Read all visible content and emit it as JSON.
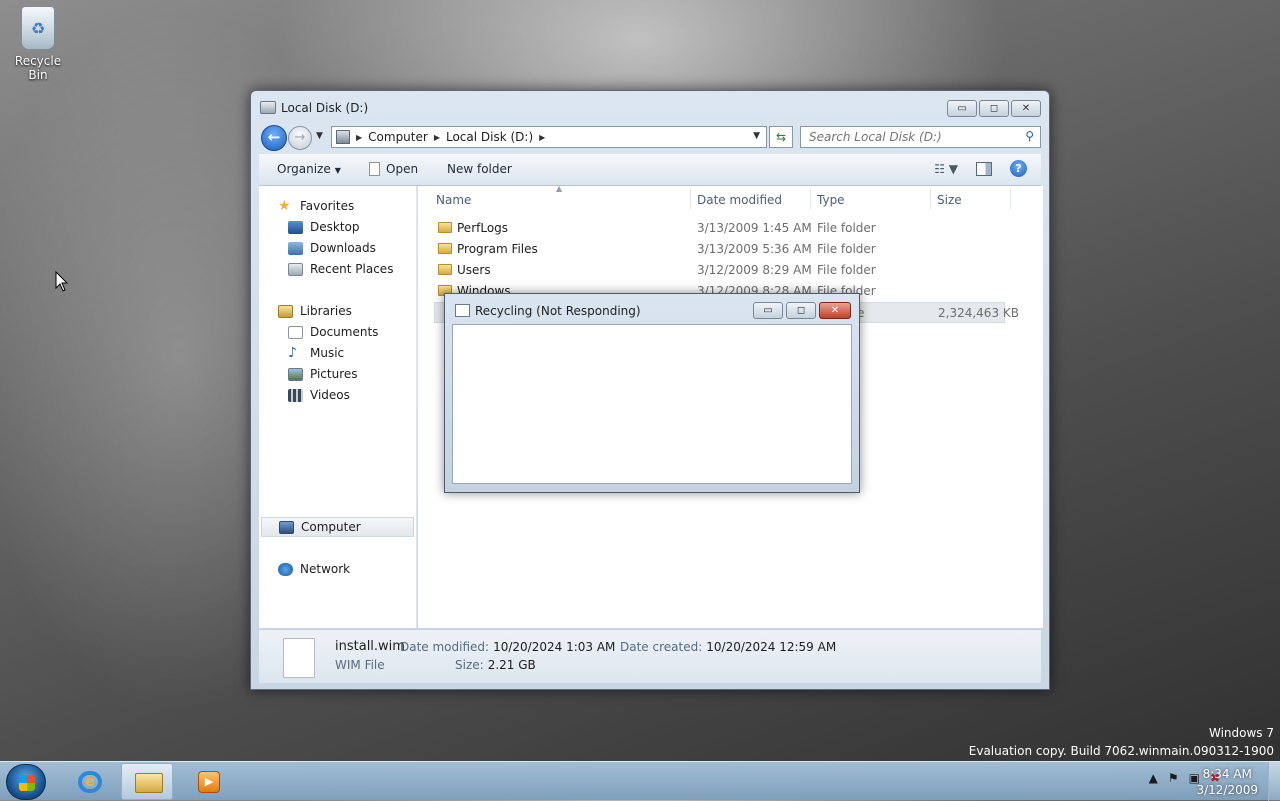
{
  "desktop": {
    "recycle_bin_label": "Recycle Bin",
    "watermark_line1": "Windows 7",
    "watermark_line2": "Evaluation copy. Build 7062.winmain.090312-1900"
  },
  "explorer": {
    "title": "Local Disk (D:)",
    "caption_buttons": {
      "minimize": "▭",
      "maximize": "◻",
      "close": "✕"
    },
    "breadcrumbs": [
      "Computer",
      "Local Disk (D:)"
    ],
    "search_placeholder": "Search Local Disk (D:)",
    "toolbar": {
      "organize": "Organize",
      "open": "Open",
      "new_folder": "New folder"
    },
    "nav": {
      "favorites": "Favorites",
      "desktop": "Desktop",
      "downloads": "Downloads",
      "recent": "Recent Places",
      "libraries": "Libraries",
      "documents": "Documents",
      "music": "Music",
      "pictures": "Pictures",
      "videos": "Videos",
      "computer": "Computer",
      "network": "Network"
    },
    "columns": {
      "name": "Name",
      "date": "Date modified",
      "type": "Type",
      "size": "Size"
    },
    "rows": [
      {
        "name": "PerfLogs",
        "date": "3/13/2009 1:45 AM",
        "type": "File folder",
        "size": ""
      },
      {
        "name": "Program Files",
        "date": "3/13/2009 5:36 AM",
        "type": "File folder",
        "size": ""
      },
      {
        "name": "Users",
        "date": "3/12/2009 8:29 AM",
        "type": "File folder",
        "size": ""
      },
      {
        "name": "Windows",
        "date": "3/12/2009 8:28 AM",
        "type": "File folder",
        "size": ""
      },
      {
        "name": "",
        "date": "",
        "type": "e",
        "size": "2,324,463 KB"
      }
    ],
    "details": {
      "file_name": "install.wim",
      "file_type": "WIM File",
      "date_modified_label": "Date modified:",
      "date_modified": "10/20/2024 1:03 AM",
      "date_created_label": "Date created:",
      "date_created": "10/20/2024 12:59 AM",
      "size_label": "Size:",
      "size": "2.21 GB"
    }
  },
  "dialog": {
    "title": "Recycling  (Not Responding)",
    "caption_buttons": {
      "minimize": "▭",
      "maximize": "◻",
      "close": "✕"
    }
  },
  "taskbar": {
    "clock_time": "8:34 AM",
    "clock_date": "3/12/2009",
    "tray_icons": [
      "show-hidden-icons",
      "action-center-flag-icon",
      "network-icon",
      "volume-muted-icon"
    ]
  }
}
